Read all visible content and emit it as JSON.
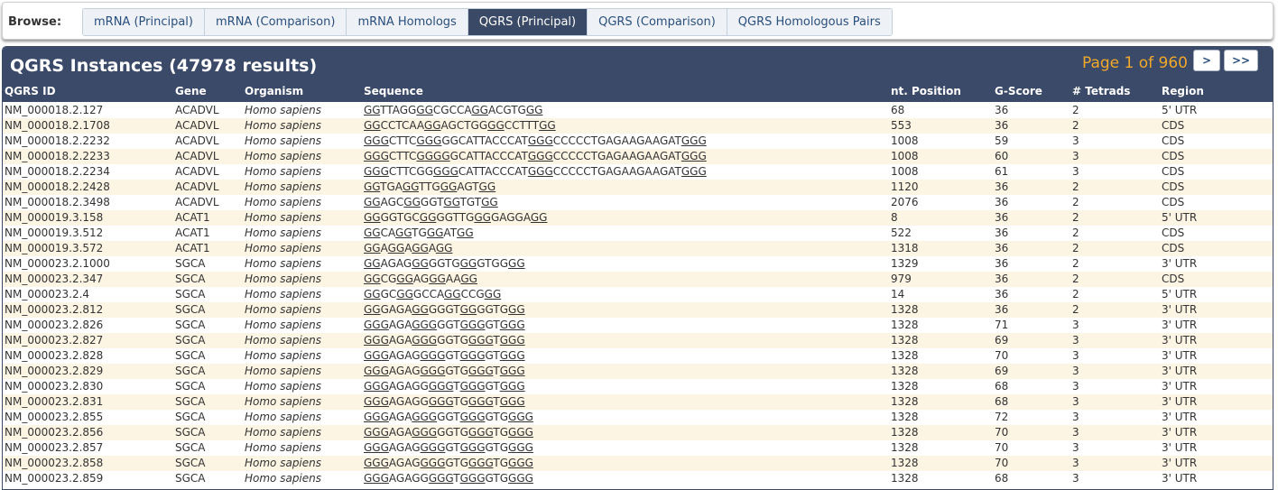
{
  "browse": {
    "label": "Browse:",
    "tabs": [
      {
        "label": "mRNA (Principal)",
        "active": false
      },
      {
        "label": "mRNA (Comparison)",
        "active": false
      },
      {
        "label": "mRNA Homologs",
        "active": false
      },
      {
        "label": "QGRS (Principal)",
        "active": true
      },
      {
        "label": "QGRS (Comparison)",
        "active": false
      },
      {
        "label": "QGRS Homologous Pairs",
        "active": false
      }
    ]
  },
  "panel": {
    "title": "QGRS Instances (47978 results)",
    "pager_text": "Page 1 of 960",
    "next_label": ">",
    "last_label": ">>"
  },
  "table": {
    "columns": [
      "QGRS ID",
      "Gene",
      "Organism",
      "Sequence",
      "nt. Position",
      "G-Score",
      "# Tetrads",
      "Region"
    ],
    "rows": [
      {
        "id": "NM_000018.2.127",
        "gene": "ACADVL",
        "organism": "Homo sapiens",
        "sequence": "GGTTAGGGGCGCCAGGACGTGGG",
        "seq_html": "<u>GG</u>TTAGG<u>GG</u>CGCCA<u>GG</u>ACGTG<u>GG</u>",
        "position": "68",
        "gscore": "36",
        "tetrads": "2",
        "region": "5' UTR"
      },
      {
        "id": "NM_000018.2.1708",
        "gene": "ACADVL",
        "organism": "Homo sapiens",
        "sequence": "GGCCTCAAGGAGCTGGGGCCTTTGG",
        "seq_html": "<u>GG</u>CCTCAA<u>GG</u>AGCTGG<u>GG</u>CCTTT<u>GG</u>",
        "position": "553",
        "gscore": "36",
        "tetrads": "2",
        "region": "CDS"
      },
      {
        "id": "NM_000018.2.2232",
        "gene": "ACADVL",
        "organism": "Homo sapiens",
        "sequence": "GGGCTTCGGGGGCATTACCCATGGGCCCCCTGAGAAGAAGATGGG",
        "seq_html": "<u>GGG</u>CTTC<u>GGG</u>GGCATTACCCAT<u>GGG</u>CCCCCTGAGAAGAAGAT<u>GGG</u>",
        "position": "1008",
        "gscore": "59",
        "tetrads": "3",
        "region": "CDS"
      },
      {
        "id": "NM_000018.2.2233",
        "gene": "ACADVL",
        "organism": "Homo sapiens",
        "sequence": "GGGCTTCGGGGGCATTACCCATGGGCCCCCTGAGAAGAAGATGGG",
        "seq_html": "<u>GGG</u>CTTC<u>G</u><u>GGG</u>GCATTACCCAT<u>GGG</u>CCCCCTGAGAAGAAGAT<u>GGG</u>",
        "position": "1008",
        "gscore": "60",
        "tetrads": "3",
        "region": "CDS"
      },
      {
        "id": "NM_000018.2.2234",
        "gene": "ACADVL",
        "organism": "Homo sapiens",
        "sequence": "GGGCTTCGGGGGCATTACCCATGGGCCCCCTGAGAAGAAGATGGG",
        "seq_html": "<u>GGG</u>CTTCGG<u>GGG</u>CATTACCCAT<u>GGG</u>CCCCCTGAGAAGAAGAT<u>GGG</u>",
        "position": "1008",
        "gscore": "61",
        "tetrads": "3",
        "region": "CDS"
      },
      {
        "id": "NM_000018.2.2428",
        "gene": "ACADVL",
        "organism": "Homo sapiens",
        "sequence": "GGTGAGGTTGGGAGTGG",
        "seq_html": "<u>GG</u>TGA<u>GG</u>TTG<u>GG</u>AGT<u>GG</u>",
        "position": "1120",
        "gscore": "36",
        "tetrads": "2",
        "region": "CDS"
      },
      {
        "id": "NM_000018.2.3498",
        "gene": "ACADVL",
        "organism": "Homo sapiens",
        "sequence": "GGAGCGGGGTGGTGTGG",
        "seq_html": "<u>GG</u>AGC<u>GG</u>GGT<u>GG</u>TGT<u>GG</u>",
        "position": "2076",
        "gscore": "36",
        "tetrads": "2",
        "region": "CDS"
      },
      {
        "id": "NM_000019.3.158",
        "gene": "ACAT1",
        "organism": "Homo sapiens",
        "sequence": "GGGGTGCGGGGTTGGGGAGGAGG",
        "seq_html": "<u>GG</u>GGTGC<u>GG</u>GGTTG<u>GG</u>GAGGA<u>GG</u>",
        "position": "8",
        "gscore": "36",
        "tetrads": "2",
        "region": "5' UTR"
      },
      {
        "id": "NM_000019.3.512",
        "gene": "ACAT1",
        "organism": "Homo sapiens",
        "sequence": "GGCAGGTGGGATGG",
        "seq_html": "<u>GG</u>CA<u>GG</u>TG<u>GG</u>AT<u>GG</u>",
        "position": "522",
        "gscore": "36",
        "tetrads": "2",
        "region": "CDS"
      },
      {
        "id": "NM_000019.3.572",
        "gene": "ACAT1",
        "organism": "Homo sapiens",
        "sequence": "GGAGGAGGAGG",
        "seq_html": "<u>GG</u>A<u>GG</u>A<u>GG</u>A<u>GG</u>",
        "position": "1318",
        "gscore": "36",
        "tetrads": "2",
        "region": "CDS"
      },
      {
        "id": "NM_000023.2.1000",
        "gene": "SGCA",
        "organism": "Homo sapiens",
        "sequence": "GGAGAGGGGGTGGGGTGGGG",
        "seq_html": "<u>GG</u>AGAG<u>GG</u>GGTG<u>GG</u>GTGG<u>GG</u>",
        "position": "1329",
        "gscore": "36",
        "tetrads": "2",
        "region": "3' UTR"
      },
      {
        "id": "NM_000023.2.347",
        "gene": "SGCA",
        "organism": "Homo sapiens",
        "sequence": "GGCGGGAGGGAAGG",
        "seq_html": "<u>GG</u>CG<u>GG</u>AG<u>GG</u>AA<u>GG</u>",
        "position": "979",
        "gscore": "36",
        "tetrads": "2",
        "region": "CDS"
      },
      {
        "id": "NM_000023.2.4",
        "gene": "SGCA",
        "organism": "Homo sapiens",
        "sequence": "GGGCGGGCCAGGCCGGG",
        "seq_html": "<u>GG</u>GC<u>GG</u>GCCA<u>GG</u>CCG<u>GG</u>",
        "position": "14",
        "gscore": "36",
        "tetrads": "2",
        "region": "5' UTR"
      },
      {
        "id": "NM_000023.2.812",
        "gene": "SGCA",
        "organism": "Homo sapiens",
        "sequence": "GGGAGAGGGGGTGGGGTGGG",
        "seq_html": "<u>GG</u>GAGA<u>GG</u>GGGT<u>GG</u>GGTG<u>GG</u>",
        "position": "1328",
        "gscore": "36",
        "tetrads": "2",
        "region": "3' UTR"
      },
      {
        "id": "NM_000023.2.826",
        "gene": "SGCA",
        "organism": "Homo sapiens",
        "sequence": "GGGAGAGGGGGTGGGGTGGG",
        "seq_html": "<u>GGG</u>AGA<u>GGG</u>GGT<u>GGG</u>GT<u>GGG</u>",
        "position": "1328",
        "gscore": "71",
        "tetrads": "3",
        "region": "3' UTR"
      },
      {
        "id": "NM_000023.2.827",
        "gene": "SGCA",
        "organism": "Homo sapiens",
        "sequence": "GGGAGAGGGGGTGGGGTGGG",
        "seq_html": "<u>GGG</u>AGA<u>GGG</u>GGTG<u>GGG</u>T<u>GGG</u>",
        "position": "1328",
        "gscore": "69",
        "tetrads": "3",
        "region": "3' UTR"
      },
      {
        "id": "NM_000023.2.828",
        "gene": "SGCA",
        "organism": "Homo sapiens",
        "sequence": "GGGAGAGGGGGTGGGGTGGG",
        "seq_html": "<u>GGG</u>AGAG<u>GGG</u>GT<u>GGG</u>GT<u>GGG</u>",
        "position": "1328",
        "gscore": "70",
        "tetrads": "3",
        "region": "3' UTR"
      },
      {
        "id": "NM_000023.2.829",
        "gene": "SGCA",
        "organism": "Homo sapiens",
        "sequence": "GGGAGAGGGGGTGGGGTGGG",
        "seq_html": "<u>GGG</u>AGAG<u>GGG</u>GTG<u>GGG</u>T<u>GGG</u>",
        "position": "1328",
        "gscore": "69",
        "tetrads": "3",
        "region": "3' UTR"
      },
      {
        "id": "NM_000023.2.830",
        "gene": "SGCA",
        "organism": "Homo sapiens",
        "sequence": "GGGAGAGGGGGTGGGGTGGG",
        "seq_html": "<u>GGG</u>AGAGG<u>GGG</u>T<u>GGG</u>GT<u>GGG</u>",
        "position": "1328",
        "gscore": "68",
        "tetrads": "3",
        "region": "3' UTR"
      },
      {
        "id": "NM_000023.2.831",
        "gene": "SGCA",
        "organism": "Homo sapiens",
        "sequence": "GGGAGAGGGGGTGGGGTGGG",
        "seq_html": "<u>GGG</u>AGAGG<u>GGG</u>TG<u>GGG</u>T<u>GGG</u>",
        "position": "1328",
        "gscore": "68",
        "tetrads": "3",
        "region": "3' UTR"
      },
      {
        "id": "NM_000023.2.855",
        "gene": "SGCA",
        "organism": "Homo sapiens",
        "sequence": "GGGAGAGGGGGTGGGGTGGGG",
        "seq_html": "<u>GGG</u>AGA<u>GGG</u>GGT<u>GGG</u>GTG<u>GGG</u>",
        "position": "1328",
        "gscore": "72",
        "tetrads": "3",
        "region": "3' UTR"
      },
      {
        "id": "NM_000023.2.856",
        "gene": "SGCA",
        "organism": "Homo sapiens",
        "sequence": "GGGAGAGGGGGTGGGGTGGGG",
        "seq_html": "<u>GGG</u>AGA<u>GGG</u>GGTG<u>GGG</u>TG<u>GGG</u>",
        "position": "1328",
        "gscore": "70",
        "tetrads": "3",
        "region": "3' UTR"
      },
      {
        "id": "NM_000023.2.857",
        "gene": "SGCA",
        "organism": "Homo sapiens",
        "sequence": "GGGAGAGGGGGTGGGGTGGGG",
        "seq_html": "<u>GGG</u>AGAG<u>GGG</u>GT<u>GGG</u>GTG<u>GGG</u>",
        "position": "1328",
        "gscore": "70",
        "tetrads": "3",
        "region": "3' UTR"
      },
      {
        "id": "NM_000023.2.858",
        "gene": "SGCA",
        "organism": "Homo sapiens",
        "sequence": "GGGAGAGGGGGTGGGGTGGGG",
        "seq_html": "<u>GGG</u>AGAG<u>GGG</u>GTG<u>GGG</u>TG<u>GGG</u>",
        "position": "1328",
        "gscore": "70",
        "tetrads": "3",
        "region": "3' UTR"
      },
      {
        "id": "NM_000023.2.859",
        "gene": "SGCA",
        "organism": "Homo sapiens",
        "sequence": "GGGAGAGGGGGTGGGGTGGGG",
        "seq_html": "<u>GGG</u>AGAGG<u>GGG</u>T<u>GGG</u>GTG<u>GGG</u>",
        "position": "1328",
        "gscore": "68",
        "tetrads": "3",
        "region": "3' UTR"
      }
    ]
  },
  "colors": {
    "header_bg": "#3b4a68",
    "active_tab_bg": "#3a4a66",
    "tab_text": "#2a4f7d",
    "pager_text": "#f0a92a",
    "alt_row_bg": "#fdf5e3"
  }
}
